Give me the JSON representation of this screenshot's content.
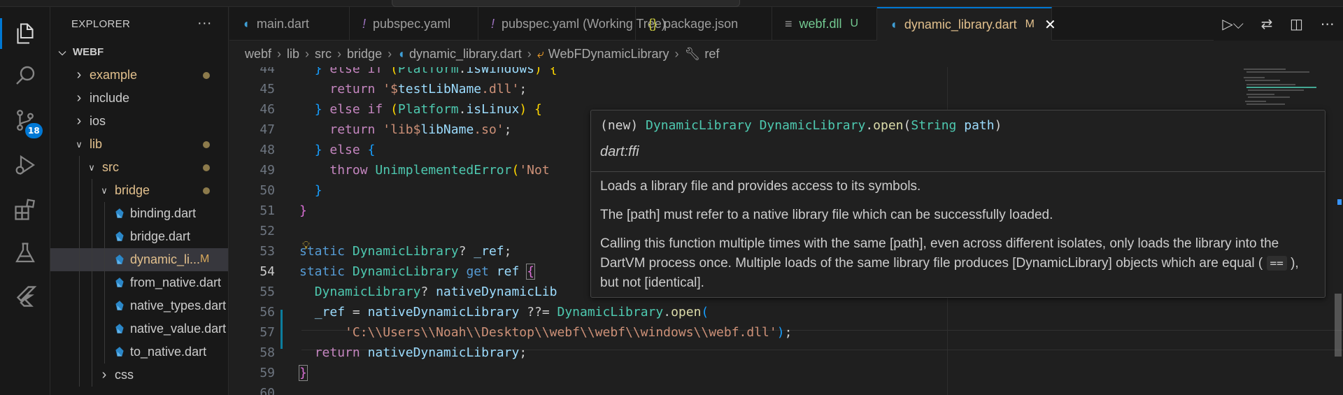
{
  "explorer": {
    "title": "EXPLORER",
    "more": "···",
    "root": "WEBF",
    "items": [
      {
        "label": "example",
        "type": "folder",
        "depth": 1,
        "open": false,
        "dot": true
      },
      {
        "label": "include",
        "type": "folder",
        "depth": 1,
        "open": false
      },
      {
        "label": "ios",
        "type": "folder",
        "depth": 1,
        "open": false
      },
      {
        "label": "lib",
        "type": "folder",
        "depth": 1,
        "open": true,
        "dot": true
      },
      {
        "label": "src",
        "type": "folder",
        "depth": 2,
        "open": true,
        "dot": true
      },
      {
        "label": "bridge",
        "type": "folder",
        "depth": 3,
        "open": true,
        "dot": true
      },
      {
        "label": "binding.dart",
        "type": "file",
        "depth": 4
      },
      {
        "label": "bridge.dart",
        "type": "file",
        "depth": 4
      },
      {
        "label": "dynamic_li...",
        "type": "file",
        "depth": 4,
        "selected": true,
        "flag": "M"
      },
      {
        "label": "from_native.dart",
        "type": "file",
        "depth": 4
      },
      {
        "label": "native_types.dart",
        "type": "file",
        "depth": 4
      },
      {
        "label": "native_value.dart",
        "type": "file",
        "depth": 4
      },
      {
        "label": "to_native.dart",
        "type": "file",
        "depth": 4
      },
      {
        "label": "css",
        "type": "folder",
        "depth": 3,
        "open": false
      }
    ]
  },
  "activity": {
    "scm_badge": "18"
  },
  "tabs": [
    {
      "label": "main.dart",
      "icon": "dart-icon",
      "color": "#9d9d9d"
    },
    {
      "label": "pubspec.yaml",
      "icon": "exclaim-icon",
      "color": "#9d9d9d"
    },
    {
      "label": "pubspec.yaml (Working Tree)",
      "icon": "exclaim-icon",
      "color": "#9d9d9d"
    },
    {
      "label": "package.json",
      "icon": "braces-icon",
      "color": "#9d9d9d"
    },
    {
      "label": "webf.dll",
      "icon": "lines-icon",
      "color": "#73c991",
      "flag": "U"
    },
    {
      "label": "dynamic_library.dart",
      "icon": "dart-icon",
      "color": "#e2c08d",
      "flag": "M",
      "active": true
    }
  ],
  "breadcrumb": [
    "webf",
    "lib",
    "src",
    "bridge",
    "dynamic_library.dart",
    "WebFDynamicLibrary",
    "ref"
  ],
  "code": {
    "lines": [
      "44",
      "45",
      "46",
      "47",
      "48",
      "49",
      "50",
      "51",
      "52",
      "53",
      "54",
      "55",
      "56",
      "57",
      "58",
      "59",
      "60"
    ],
    "current_line": "54"
  },
  "hover": {
    "sig_new": "(new)",
    "sig_type": "DynamicLibrary",
    "sig_class": "DynamicLibrary",
    "sig_dot": ".",
    "sig_method": "open",
    "sig_paren_open": "(",
    "sig_param_type": "String",
    "sig_param": " path",
    "sig_paren_close": ")",
    "library": "dart:ffi",
    "p1": "Loads a library file and provides access to its symbols.",
    "p2": "The [path] must refer to a native library file which can be successfully loaded.",
    "p3a": "Calling this function multiple times with the same [path], even across different isolates, only loads the library into the DartVM process once. Multiple loads of the same library file produces [DynamicLibrary] objects which are equal (",
    "p3code": "==",
    "p3b": "), but not [identical]."
  },
  "colors": {
    "accent": "#0078d4",
    "modified": "#e2c08d",
    "untracked": "#73c991"
  }
}
